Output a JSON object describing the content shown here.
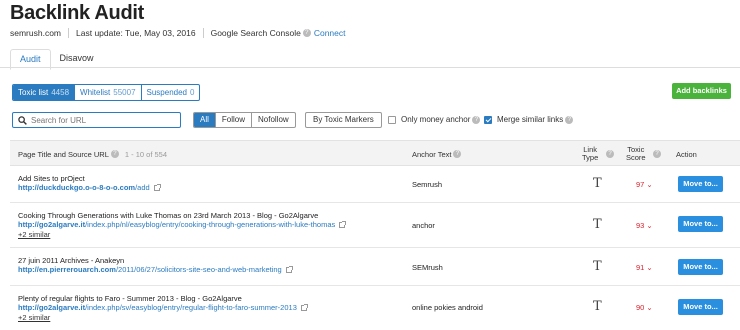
{
  "page": {
    "title": "Backlink Audit",
    "domain": "semrush.com",
    "last_update": "Last update: Tue, May 03, 2016",
    "gsc_label": "Google Search Console",
    "gsc_connect": "Connect"
  },
  "tabs": [
    {
      "label": "Audit",
      "active": true
    },
    {
      "label": "Disavow",
      "active": false
    }
  ],
  "list_tabs": [
    {
      "label": "Toxic list",
      "count": "4458",
      "active": true
    },
    {
      "label": "Whitelist",
      "count": "55007",
      "active": false
    },
    {
      "label": "Suspended",
      "count": "0",
      "active": false
    }
  ],
  "add_backlinks_label": "Add backlinks",
  "search": {
    "placeholder": "Search for URL",
    "value": ""
  },
  "filters": [
    {
      "label": "All",
      "active": true
    },
    {
      "label": "Follow",
      "active": false
    },
    {
      "label": "Nofollow",
      "active": false
    }
  ],
  "toxic_markers_label": "By Toxic Markers",
  "options": {
    "only_money_anchor": {
      "label": "Only money anchor",
      "checked": false
    },
    "merge_similar": {
      "label": "Merge similar links",
      "checked": true
    }
  },
  "table": {
    "headers": {
      "page": "Page Title and Source URL",
      "range": "1 - 10 of 554",
      "anchor": "Anchor Text",
      "link_type_1": "Link",
      "link_type_2": "Type",
      "toxic_1": "Toxic",
      "toxic_2": "Score",
      "action": "Action"
    },
    "rows": [
      {
        "title": "Add Sites to prOject",
        "url_host": "http://duckduckgo.o-o-8-o-o.com",
        "url_path": "/add",
        "similar": "",
        "anchor": "Semrush",
        "link_type": "T",
        "score": "97",
        "action": "Move to..."
      },
      {
        "title": "Cooking Through Generations with Luke Thomas on 23rd March 2013 - Blog - Go2Algarve",
        "url_host": "http://go2algarve.it",
        "url_path": "/index.php/nl/easyblog/entry/cooking-through-generations-with-luke-thomas",
        "similar": "+2 similar",
        "anchor": "anchor",
        "link_type": "T",
        "score": "93",
        "action": "Move to..."
      },
      {
        "title": "27 juin 2011 Archives - Anakeyn",
        "url_host": "http://en.pierrerouarch.com",
        "url_path": "/2011/06/27/solicitors-site-seo-and-web-marketing",
        "similar": "",
        "anchor": "SEMrush",
        "link_type": "T",
        "score": "91",
        "action": "Move to..."
      },
      {
        "title": "Plenty of regular flights to Faro - Summer 2013 - Blog - Go2Algarve",
        "url_host": "http://go2algarve.it",
        "url_path": "/index.php/sv/easyblog/entry/regular-flight-to-faro-summer-2013",
        "similar": "+2 similar",
        "anchor": "online pokies android",
        "link_type": "T",
        "score": "90",
        "action": "Move to..."
      }
    ]
  },
  "colors": {
    "accent": "#2b7bc0",
    "green": "#4ab33c",
    "toxic": "#d9232d"
  }
}
